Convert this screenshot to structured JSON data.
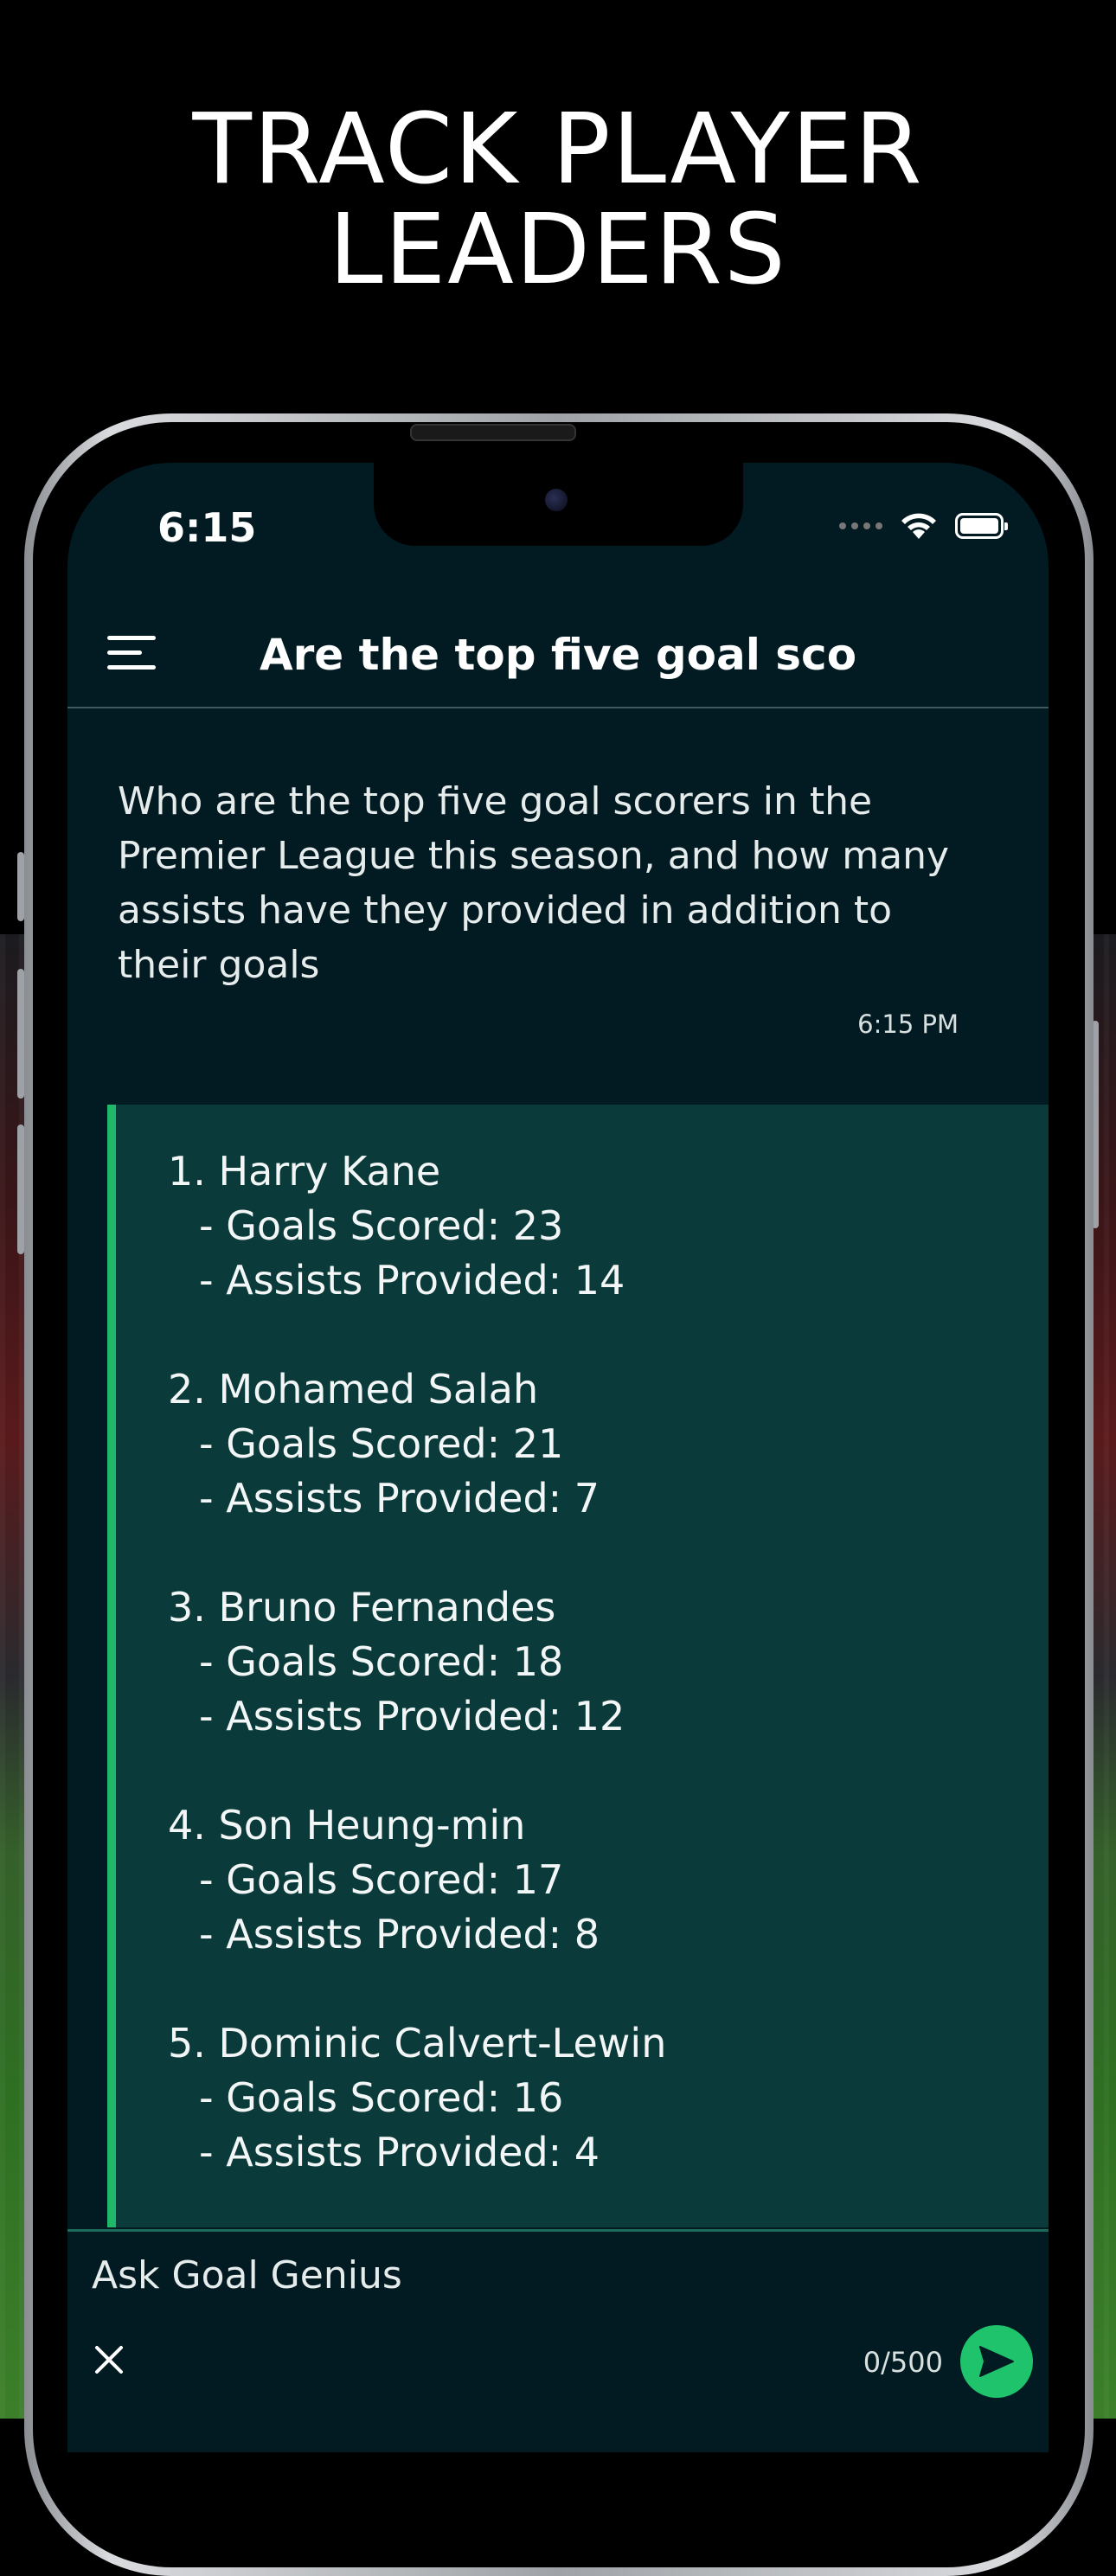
{
  "headline": {
    "line1": "TRACK PLAYER",
    "line2": "LEADERS"
  },
  "status_bar": {
    "time": "6:15"
  },
  "nav": {
    "title": "Are the top five goal sco"
  },
  "question": {
    "text": "Who are the top five goal scorers in the Premier League this season, and how many assists have they provided in addition to their goals",
    "time": "6:15 PM"
  },
  "answer": {
    "items": [
      {
        "name": "1. Harry Kane",
        "goals": "- Goals Scored: 23",
        "assists": "- Assists Provided: 14"
      },
      {
        "name": "2. Mohamed Salah",
        "goals": "- Goals Scored: 21",
        "assists": "- Assists Provided: 7"
      },
      {
        "name": "3. Bruno Fernandes",
        "goals": "- Goals Scored: 18",
        "assists": "- Assists Provided: 12"
      },
      {
        "name": "4. Son Heung-min",
        "goals": "- Goals Scored: 17",
        "assists": "- Assists Provided: 8"
      },
      {
        "name": "5. Dominic Calvert-Lewin",
        "goals": "- Goals Scored: 16",
        "assists": "- Assists Provided: 4"
      }
    ]
  },
  "composer": {
    "placeholder": "Ask Goal Genius",
    "value": "",
    "counter": "0/500"
  },
  "icons": {
    "menu": "menu-icon",
    "close": "close-icon",
    "send": "send-icon",
    "wifi": "wifi-icon",
    "battery": "battery-icon"
  },
  "colors": {
    "screen_bg": "#021b22",
    "answer_bg": "#0a3a39",
    "accent": "#1fb868",
    "send_button": "#1fc36b"
  }
}
